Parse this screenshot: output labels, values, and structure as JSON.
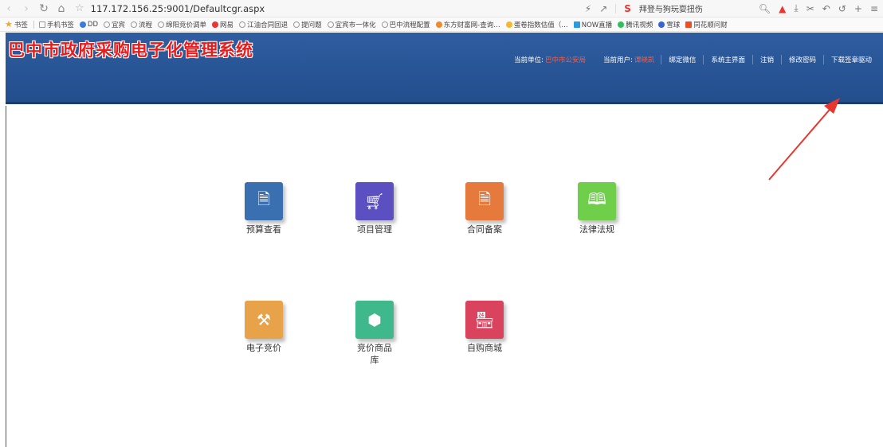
{
  "browser": {
    "url": "117.172.156.25:9001/Defaultcgr.aspx",
    "search_hint": "拜登与狗玩耍扭伤",
    "bookmarks": [
      "书签",
      "手机书签",
      "DD",
      "宜宾",
      "流程",
      "绵阳竞价调单",
      "网易",
      "江油合同回退",
      "提问题",
      "宜宾市一体化",
      "巴中流程配置",
      "东方财富网-查询…",
      "蛋卷指数估值（…",
      "NOW直播",
      "腾讯视频",
      "雪球",
      "同花顺问财"
    ]
  },
  "header": {
    "title": "巴中市政府采购电子化管理系统",
    "unit_label": "当前单位:",
    "unit_value": "巴中市公安局",
    "user_label": "当前用户:",
    "user_value": "谭晓凯",
    "links": [
      "绑定微信",
      "系统主界面",
      "注销",
      "修改密码",
      "下载签章驱动"
    ]
  },
  "tiles": [
    {
      "label": "预算查看",
      "color": "#3a6fb0",
      "icon": "document-check-icon"
    },
    {
      "label": "项目管理",
      "color": "#5b4fc1",
      "icon": "cart-icon"
    },
    {
      "label": "合同备案",
      "color": "#e67a3c",
      "icon": "contract-icon"
    },
    {
      "label": "法律法规",
      "color": "#6fce4a",
      "icon": "book-icon"
    },
    {
      "label": "电子竞价",
      "color": "#e8a34a",
      "icon": "gavel-icon"
    },
    {
      "label": "竞价商品库",
      "color": "#3fb88c",
      "icon": "box-icon"
    },
    {
      "label": "自购商城",
      "color": "#d9435e",
      "icon": "store-icon"
    }
  ],
  "colors": {
    "header_bg": "#2a579a",
    "title_red": "#e81c1c",
    "arrow_red": "#e8352e"
  }
}
